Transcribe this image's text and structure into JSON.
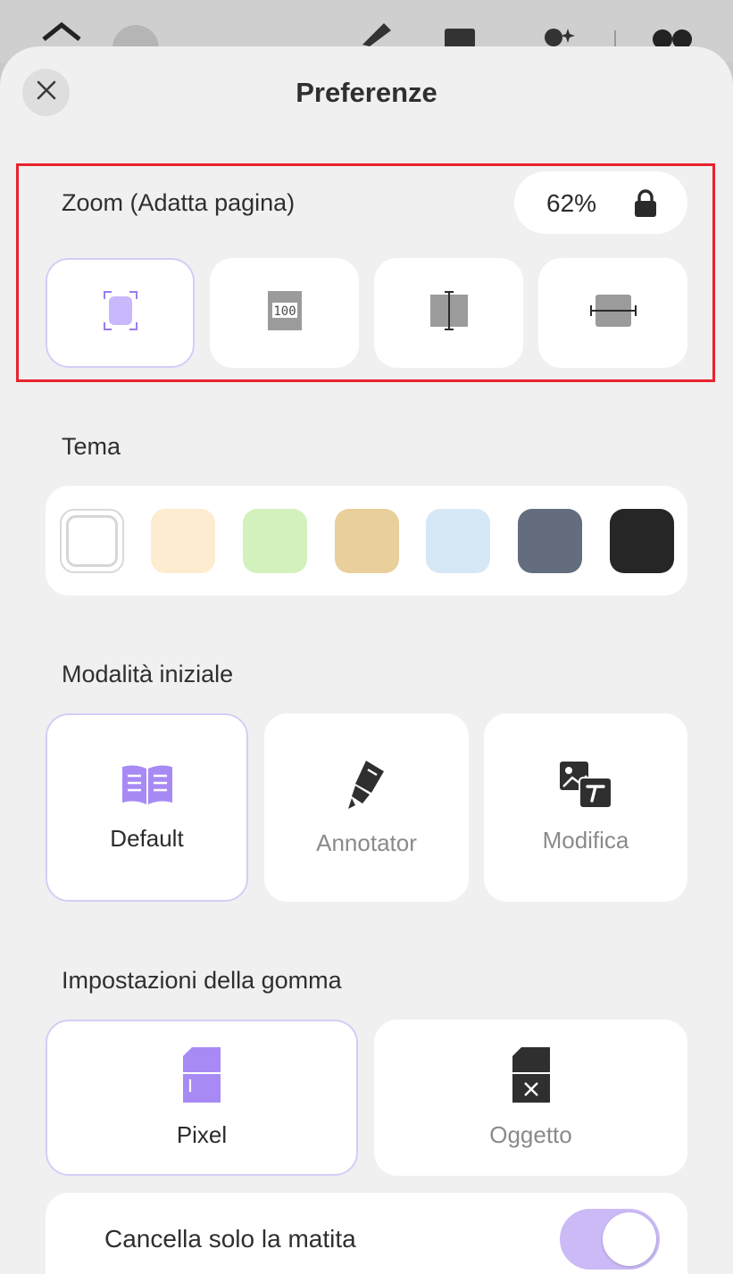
{
  "header": {
    "title": "Preferenze"
  },
  "zoom": {
    "label": "Zoom (Adatta pagina)",
    "value": "62%",
    "options": [
      {
        "icon": "fit-page-icon",
        "selected": true
      },
      {
        "icon": "actual-size-icon",
        "selected": false
      },
      {
        "icon": "fit-width-icon",
        "selected": false
      },
      {
        "icon": "fit-height-icon",
        "selected": false
      }
    ]
  },
  "theme": {
    "label": "Tema",
    "swatches": [
      "#ffffff",
      "#fdecd0",
      "#d2f1bd",
      "#e9cf9b",
      "#d6e7f6",
      "#636d7e",
      "#262626"
    ]
  },
  "start_mode": {
    "label": "Modalità iniziale",
    "options": [
      {
        "label": "Default",
        "icon": "book-icon",
        "selected": true
      },
      {
        "label": "Annotator",
        "icon": "highlighter-icon",
        "selected": false
      },
      {
        "label": "Modifica",
        "icon": "edit-image-text-icon",
        "selected": false
      }
    ]
  },
  "eraser": {
    "label": "Impostazioni della gomma",
    "options": [
      {
        "label": "Pixel",
        "icon": "pixel-eraser-icon",
        "selected": true
      },
      {
        "label": "Oggetto",
        "icon": "object-eraser-icon",
        "selected": false
      }
    ],
    "pencil_only_label": "Cancella solo la matita",
    "pencil_only_enabled": true
  },
  "colors": {
    "accent": "#a88af5",
    "accent_light": "#d7ccf7",
    "highlight_box": "#e8232e"
  }
}
